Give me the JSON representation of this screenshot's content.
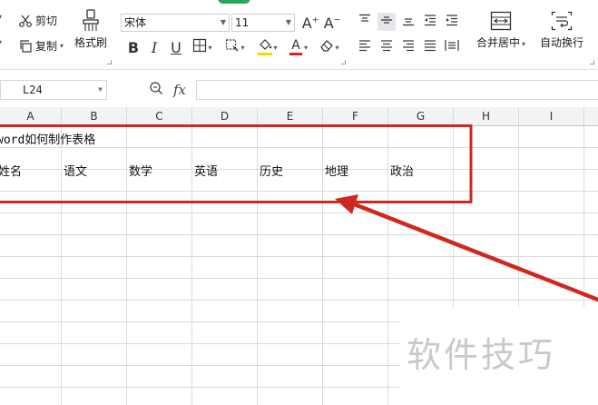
{
  "ribbon": {
    "cut_label": "剪切",
    "copy_label": "复制",
    "format_painter_label": "格式刷",
    "font_name": "宋体",
    "font_size": "11",
    "bold": "B",
    "italic": "I",
    "underline": "U",
    "merge_center_label": "合并居中",
    "wrap_text_label": "自动换行"
  },
  "formula_bar": {
    "name_box": "L24",
    "fx_label": "fx",
    "formula": ""
  },
  "columns": [
    "A",
    "B",
    "C",
    "D",
    "E",
    "F",
    "G",
    "H",
    "I"
  ],
  "sheet": {
    "title_cell": "word如何制作表格",
    "headers": [
      "姓名",
      "语文",
      "数学",
      "英语",
      "历史",
      "地理",
      "政治"
    ]
  },
  "watermark": "软件技巧",
  "colors": {
    "highlight_box": "#d0281e",
    "arrow": "#d0281e",
    "ribbon_accent": "#26a65b",
    "font_color_bar": "#e02020",
    "fill_color_bar": "#f5d800"
  }
}
